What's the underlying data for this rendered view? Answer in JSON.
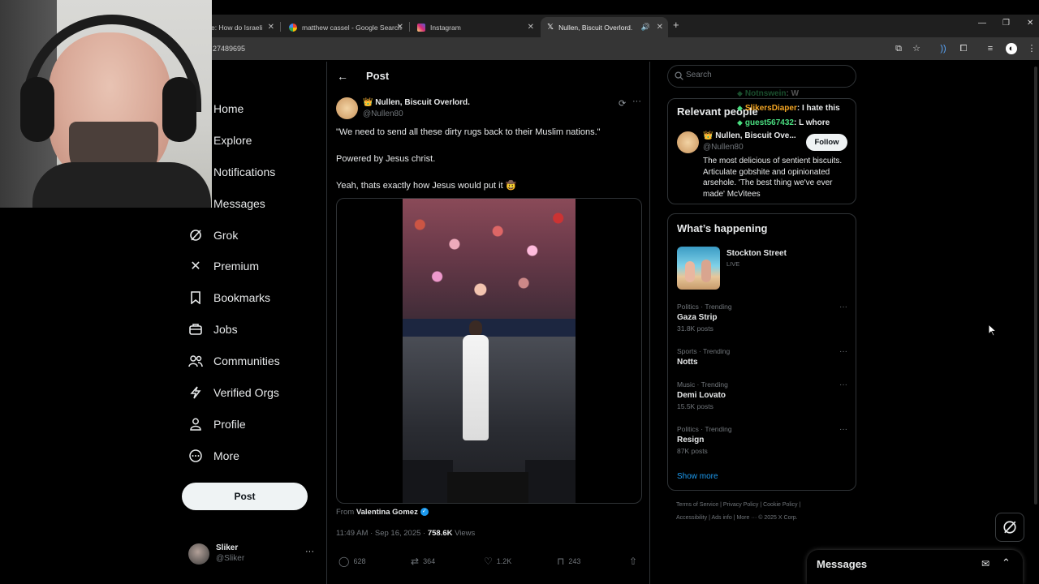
{
  "browser": {
    "tabs": [
      {
        "title": "e: How do Israeli"
      },
      {
        "title": "matthew cassel - Google Search"
      },
      {
        "title": "Instagram"
      },
      {
        "title": "Nullen, Biscuit Overlord."
      }
    ],
    "url_fragment": "27489695"
  },
  "nav": {
    "items": [
      {
        "label": "Home",
        "icon": "home-icon"
      },
      {
        "label": "Explore",
        "icon": "search-icon"
      },
      {
        "label": "Notifications",
        "icon": "bell-icon"
      },
      {
        "label": "Messages",
        "icon": "mail-icon"
      },
      {
        "label": "Grok",
        "icon": "grok-icon"
      },
      {
        "label": "Premium",
        "icon": "x-logo-icon"
      },
      {
        "label": "Bookmarks",
        "icon": "bookmark-icon"
      },
      {
        "label": "Jobs",
        "icon": "briefcase-icon"
      },
      {
        "label": "Communities",
        "icon": "people-icon"
      },
      {
        "label": "Verified Orgs",
        "icon": "lightning-icon"
      },
      {
        "label": "Profile",
        "icon": "person-icon"
      },
      {
        "label": "More",
        "icon": "more-circle-icon"
      }
    ],
    "post_button": "Post",
    "account": {
      "name": "Sliker",
      "handle": "@Sliker"
    }
  },
  "main": {
    "header_title": "Post",
    "author": {
      "name": "👑 Nullen, Biscuit Overlord.",
      "handle": "@Nullen80"
    },
    "text_lines": [
      "\"We need to send all these dirty rugs back to their Muslim nations.\"",
      "Powered by Jesus christ.",
      "Yeah, thats exactly how Jesus would put it 🤠"
    ],
    "media_from_prefix": "From",
    "media_from_name": "Valentina Gomez",
    "timestamp": "11:49 AM · Sep 16, 2025 ·",
    "views_count": "758.6K",
    "views_label": "Views",
    "actions": {
      "replies": "628",
      "reposts": "364",
      "likes": "1.2K",
      "bookmarks": "243"
    }
  },
  "sidebar": {
    "search_placeholder": "Search",
    "relevant": {
      "title": "Relevant people",
      "name": "👑 Nullen, Biscuit Ove...",
      "handle": "@Nullen80",
      "follow_label": "Follow",
      "bio": "The most delicious of sentient biscuits. Articulate gobshite and opinionated arsehole. 'The best thing we've ever made' McVitees"
    },
    "happening": {
      "title": "What’s happening",
      "live": {
        "title": "Stockton Street",
        "badge": "LIVE"
      },
      "trends": [
        {
          "context": "Politics · Trending",
          "name": "Gaza Strip",
          "count": "31.8K posts"
        },
        {
          "context": "Sports · Trending",
          "name": "Notts",
          "count": ""
        },
        {
          "context": "Music · Trending",
          "name": "Demi Lovato",
          "count": "15.5K posts"
        },
        {
          "context": "Politics · Trending",
          "name": "Resign",
          "count": "87K posts"
        }
      ],
      "show_more": "Show more"
    },
    "footer": {
      "line1": "Terms of Service  |  Privacy Policy  |  Cookie Policy  |",
      "line2": "Accessibility  |  Ads info  |  More ···  © 2025 X Corp."
    }
  },
  "chat_overlay": [
    {
      "user": "Notnswein",
      "message": ": W"
    },
    {
      "user": "SlikersDiaper",
      "message": ": I hate this"
    },
    {
      "user": "guest567432",
      "message": ": L whore"
    }
  ],
  "messages_drawer": {
    "title": "Messages"
  },
  "colors": {
    "accent": "#1d9bf0",
    "background": "#000000",
    "text": "#e7e9ea",
    "muted": "#71767b",
    "chat_green": "#4ade80",
    "chat_orange": "#f5a623"
  }
}
